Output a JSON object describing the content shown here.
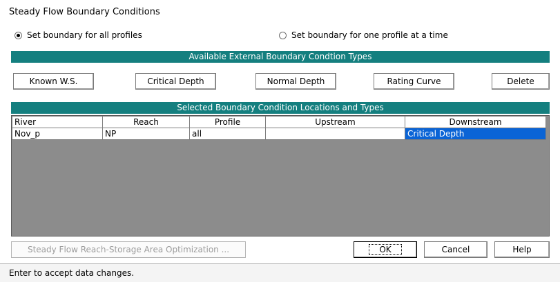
{
  "window": {
    "title": "Steady Flow Boundary Conditions"
  },
  "mode": {
    "all_profiles_label": "Set boundary for all profiles",
    "one_profile_label": "Set boundary for one profile at a time",
    "selected": "all"
  },
  "types_bar": {
    "title": "Available External Boundary Condtion Types"
  },
  "type_buttons": {
    "known_ws": "Known W.S.",
    "critical_depth": "Critical Depth",
    "normal_depth": "Normal Depth",
    "rating_curve": "Rating Curve",
    "delete": "Delete"
  },
  "locations_bar": {
    "title": "Selected Boundary Condition Locations and Types"
  },
  "table": {
    "headers": [
      "River",
      "Reach",
      "Profile",
      "Upstream",
      "Downstream"
    ],
    "rows": [
      [
        "Nov_p",
        "NP",
        "all",
        "",
        "Critical Depth"
      ]
    ],
    "selected_cell": "downstream"
  },
  "bottom_buttons": {
    "optimization": "Steady Flow Reach-Storage Area Optimization ...",
    "ok": "OK",
    "cancel": "Cancel",
    "help": "Help"
  },
  "status_bar": {
    "text": "Enter to accept data changes."
  },
  "colors": {
    "header_bar": "#147f7f",
    "selection": "#0a64d6",
    "grid_background": "#8c8c8c"
  }
}
